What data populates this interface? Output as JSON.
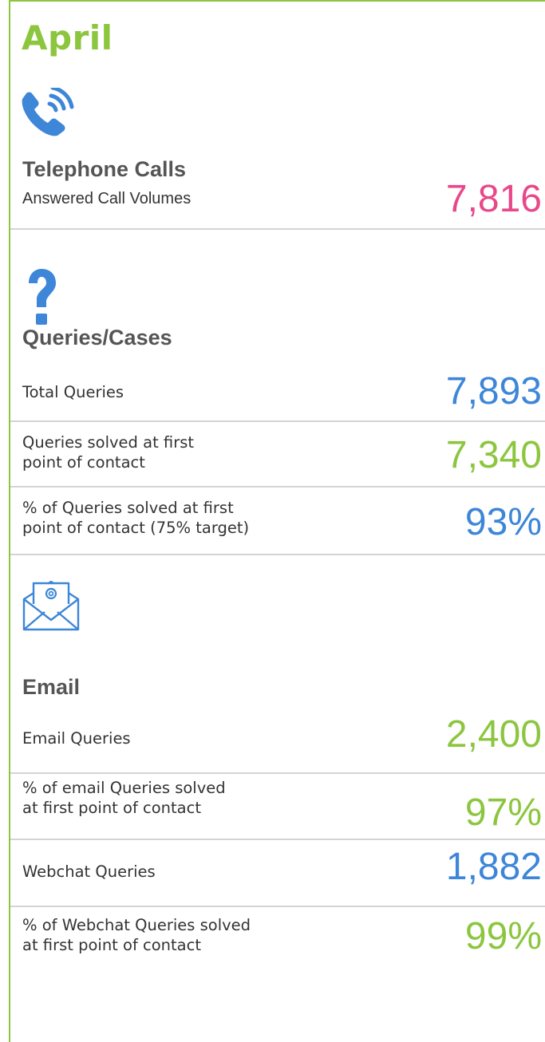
{
  "month_title": "April",
  "colors": {
    "pink": "#e8488a",
    "blue": "#3d86d8",
    "green": "#8cc63f",
    "frame": "#8cc63f"
  },
  "sections": [
    {
      "icon": "phone-icon",
      "title": "Telephone Calls",
      "rows": [
        {
          "label": "Answered Call Volumes",
          "value": "7,816",
          "color": "pink"
        }
      ]
    },
    {
      "icon": "question-icon",
      "title": "Queries/Cases",
      "rows": [
        {
          "label": "Total Queries",
          "value": "7,893",
          "color": "blue"
        },
        {
          "label": "Queries solved at first point of contact",
          "value": "7,340",
          "color": "green"
        },
        {
          "label": "% of Queries solved at first point of contact (75% target)",
          "value": "93%",
          "color": "blue"
        }
      ]
    },
    {
      "icon": "email-icon",
      "title": "Email",
      "rows": [
        {
          "label": "Email Queries",
          "value": "2,400",
          "color": "green"
        },
        {
          "label": "% of email Queries solved at first point of contact",
          "value": "97%",
          "color": "green"
        },
        {
          "label": "Webchat Queries",
          "value": "1,882",
          "color": "blue"
        },
        {
          "label": "% of Webchat Queries solved at first point of contact",
          "value": "99%",
          "color": "green"
        }
      ]
    }
  ],
  "label_lines": {
    "q2_line1": "Queries solved at first",
    "q2_line2": "point of contact",
    "q3_line1": "% of Queries solved at first",
    "q3_line2": "point of contact (75% target)",
    "e2_line1": "% of email Queries solved",
    "e2_line2": "at first point of contact",
    "e4_line1": "% of Webchat Queries solved",
    "e4_line2": "at first point of contact"
  }
}
